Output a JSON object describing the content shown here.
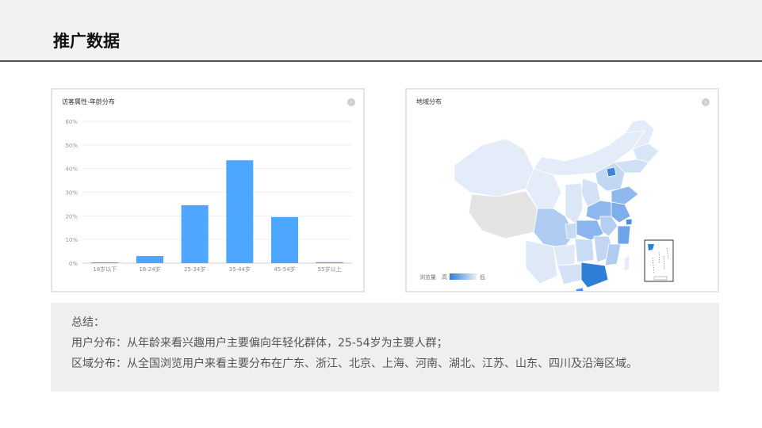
{
  "header": {
    "title": "推广数据"
  },
  "age_panel": {
    "title": "访客属性-年龄分布"
  },
  "map_panel": {
    "title": "地域分布",
    "legend": {
      "label": "浏览量",
      "high": "高",
      "low": "低"
    }
  },
  "chart_data": {
    "type": "bar",
    "title": "访客属性-年龄分布",
    "categories": [
      "18岁以下",
      "18-24岁",
      "25-34岁",
      "35-44岁",
      "45-54岁",
      "55岁以上"
    ],
    "values": [
      0.3,
      3,
      24.5,
      43.5,
      19.5,
      0.4
    ],
    "yticks": [
      "0%",
      "10%",
      "20%",
      "30%",
      "40%",
      "50%",
      "60%"
    ],
    "ylim": [
      0,
      60
    ],
    "color": "#4da6ff",
    "grid": true
  },
  "summary": {
    "line1": "总结：",
    "line2": "用户分布：从年龄来看兴趣用户主要偏向年轻化群体，25-54岁为主要人群；",
    "line3": "区域分布：从全国浏览用户来看主要分布在广东、浙江、北京、上海、河南、湖北、江苏、山东、四川及沿海区域。"
  },
  "colors": {
    "bar": "#4da6ff",
    "map_high": "#2f7fd6",
    "map_low": "#e8f0fb"
  }
}
